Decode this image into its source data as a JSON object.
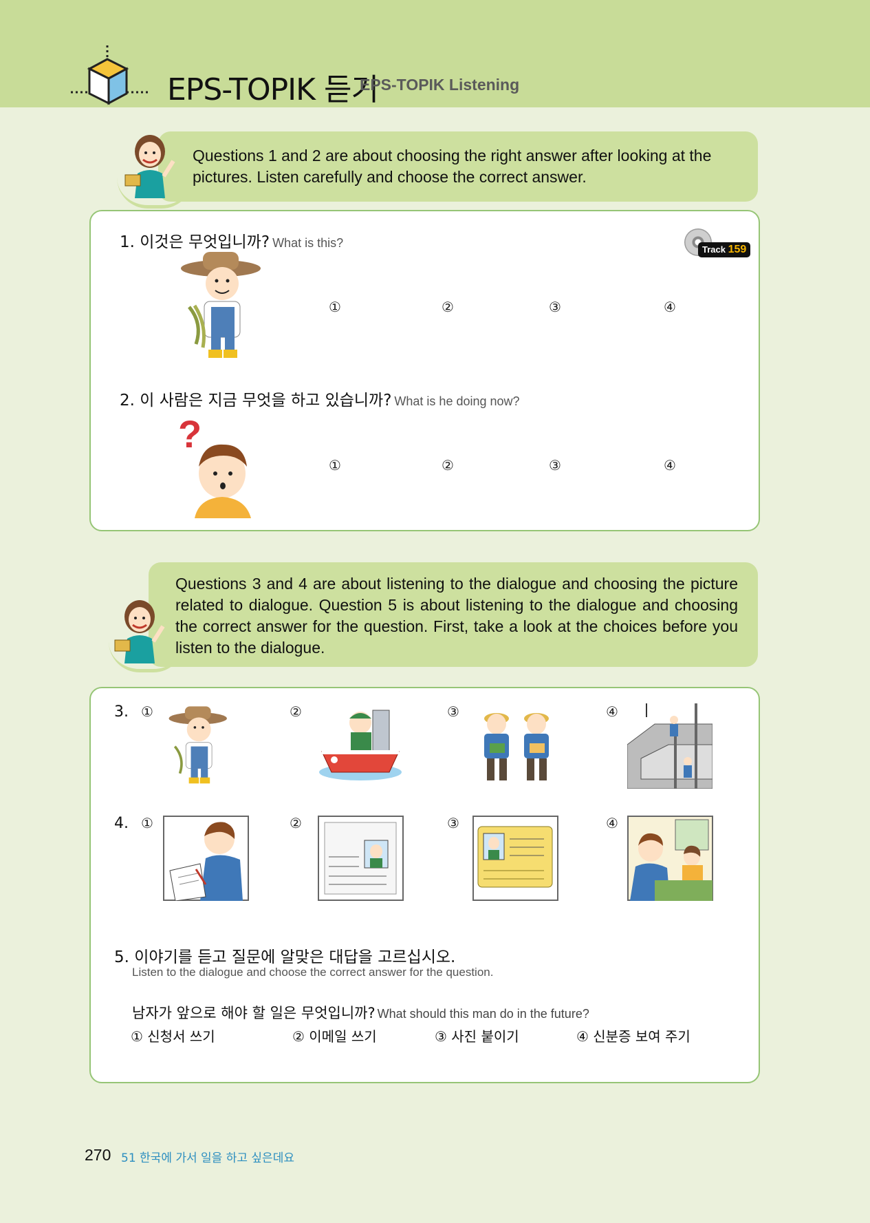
{
  "header": {
    "title": "EPS-TOPIK 듣기",
    "subtitle": "EPS-TOPIK Listening"
  },
  "instruction1": "Questions 1 and 2 are about choosing the right answer after looking at the pictures. Listen carefully and choose the correct answer.",
  "track": {
    "prefix": "Track",
    "number": "159"
  },
  "q1": {
    "number_ko": "1. 이것은 무엇입니까?",
    "en": "What is this?",
    "options": [
      "①",
      "②",
      "③",
      "④"
    ]
  },
  "q2": {
    "number_ko": "2. 이 사람은 지금 무엇을 하고 있습니까?",
    "en": "What is he doing now?",
    "options": [
      "①",
      "②",
      "③",
      "④"
    ]
  },
  "instruction2": "Questions 3 and 4 are about listening to the dialogue and choosing the picture related to dialogue. Question 5 is about listening to the dialogue and choosing the correct answer for the question. First, take a look at the choices before you listen to the dialogue.",
  "q3": {
    "number": "3.",
    "options": [
      "①",
      "②",
      "③",
      "④"
    ]
  },
  "q4": {
    "number": "4.",
    "options": [
      "①",
      "②",
      "③",
      "④"
    ]
  },
  "q5": {
    "number_ko": "5. 이야기를 듣고 질문에 알맞은 대답을 고르십시오.",
    "en": "Listen to the dialogue and choose the correct answer for the question.",
    "question_ko": "남자가 앞으로 해야 할 일은 무엇입니까?",
    "question_en": "What should this man do in the future?",
    "answers": [
      "① 신청서 쓰기",
      "② 이메일 쓰기",
      "③ 사진 붙이기",
      "④ 신분증 보여 주기"
    ]
  },
  "footer": {
    "page": "270",
    "chapter": "51 한국에 가서 일을 하고 싶은데요"
  },
  "colors": {
    "header_band": "#c8dc98",
    "bubble": "#cde09f",
    "panel_border": "#96c576",
    "page_bg": "#ebf1dc"
  }
}
